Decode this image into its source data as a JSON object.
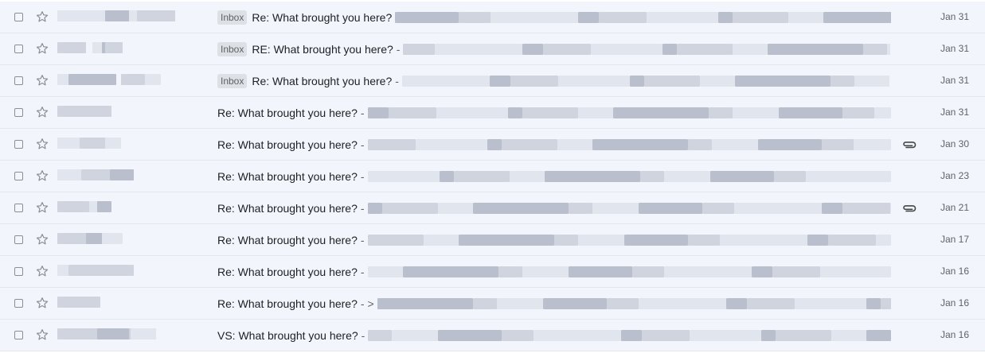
{
  "emails": [
    {
      "label": "Inbox",
      "subject": "Re: What brought you here?",
      "separator": "",
      "date": "Jan 31",
      "attachment": false
    },
    {
      "label": "Inbox",
      "subject": "RE: What brought you here?",
      "separator": "-",
      "date": "Jan 31",
      "attachment": false
    },
    {
      "label": "Inbox",
      "subject": "Re: What brought you here?",
      "separator": "-",
      "date": "Jan 31",
      "attachment": false
    },
    {
      "label": "",
      "subject": "Re: What brought you here?",
      "separator": "-",
      "date": "Jan 31",
      "attachment": false
    },
    {
      "label": "",
      "subject": "Re: What brought you here?",
      "separator": "-",
      "date": "Jan 30",
      "attachment": true
    },
    {
      "label": "",
      "subject": "Re: What brought you here?",
      "separator": "-",
      "date": "Jan 23",
      "attachment": false
    },
    {
      "label": "",
      "subject": "Re: What brought you here?",
      "separator": "-",
      "date": "Jan 21",
      "attachment": true
    },
    {
      "label": "",
      "subject": "Re: What brought you here?",
      "separator": "-",
      "date": "Jan 17",
      "attachment": false
    },
    {
      "label": "",
      "subject": "Re: What brought you here?",
      "separator": "-",
      "date": "Jan 16",
      "attachment": false
    },
    {
      "label": "",
      "subject": "Re: What brought you here?",
      "separator": "- >",
      "date": "Jan 16",
      "attachment": false
    },
    {
      "label": "",
      "subject": "VS: What brought you here?",
      "separator": "-",
      "date": "Jan 16",
      "attachment": false
    }
  ],
  "icons": {
    "checkbox": "checkbox-icon",
    "star": "star-outline-icon",
    "attachment": "paperclip-icon"
  },
  "colors": {
    "row_bg": "#f2f6fc",
    "badge_bg": "#dde1e6",
    "text": "#202124",
    "muted": "#5f6368"
  }
}
